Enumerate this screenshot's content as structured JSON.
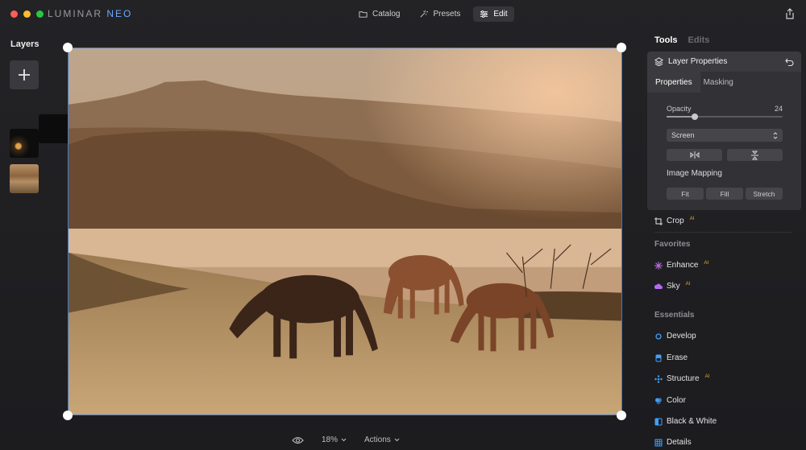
{
  "app": {
    "brand_main": "LUMINAR",
    "brand_accent": "NEO"
  },
  "nav": {
    "catalog": "Catalog",
    "presets": "Presets",
    "edit": "Edit"
  },
  "layers": {
    "title": "Layers"
  },
  "bottom": {
    "zoom": "18%",
    "actions": "Actions"
  },
  "right_tabs": {
    "tools": "Tools",
    "edits": "Edits"
  },
  "layer_properties": {
    "title": "Layer Properties",
    "tab_properties": "Properties",
    "tab_masking": "Masking",
    "opacity_label": "Opacity",
    "opacity_value": "24",
    "opacity_fraction": 0.24,
    "blend_mode": "Screen",
    "image_mapping": "Image Mapping",
    "fit": "Fit",
    "fill": "Fill",
    "stretch": "Stretch"
  },
  "tools": {
    "crop": "Crop",
    "favorites": "Favorites",
    "enhance": "Enhance",
    "sky": "Sky",
    "essentials": "Essentials",
    "develop": "Develop",
    "erase": "Erase",
    "structure": "Structure",
    "color": "Color",
    "bw": "Black & White",
    "details": "Details",
    "ai_badge": "AI"
  },
  "colors": {
    "accent": "#3e7bd6",
    "ai": "#f0a33a"
  }
}
